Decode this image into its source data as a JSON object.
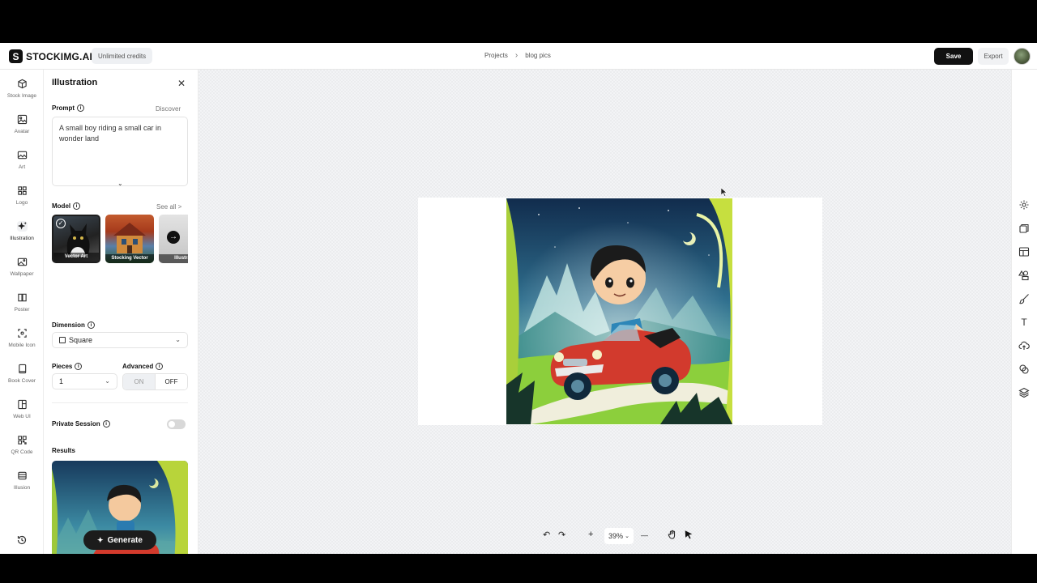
{
  "app": {
    "logo_letter": "S",
    "logo_text": "STOCKIMG.AI",
    "credits_badge": "Unlimited credits"
  },
  "breadcrumb": {
    "projects": "Projects",
    "separator": "›",
    "current": "blog pics"
  },
  "header_actions": {
    "save_label": "Save",
    "export_label": "Export"
  },
  "rail": {
    "items": [
      {
        "label": "Stock Image",
        "icon": "cube-icon"
      },
      {
        "label": "Avatar",
        "icon": "avatar-frame-icon"
      },
      {
        "label": "Art",
        "icon": "image-icon"
      },
      {
        "label": "Logo",
        "icon": "grid-icon"
      },
      {
        "label": "Illustration",
        "icon": "sparkle-icon",
        "active": true
      },
      {
        "label": "Wallpaper",
        "icon": "wallpaper-icon"
      },
      {
        "label": "Poster",
        "icon": "poster-icon"
      },
      {
        "label": "Mobile Icon",
        "icon": "mobile-icon-icon"
      },
      {
        "label": "Book Cover",
        "icon": "book-icon"
      },
      {
        "label": "Web UI",
        "icon": "web-ui-icon"
      },
      {
        "label": "QR Code",
        "icon": "qr-code-icon"
      },
      {
        "label": "Illusion",
        "icon": "illusion-icon"
      }
    ],
    "history_icon": "history-icon"
  },
  "panel": {
    "title": "Illustration",
    "close": "✕",
    "prompt_label": "Prompt",
    "discover_link": "Discover",
    "prompt_text": "A small  boy riding a small car in wonder land",
    "expand": "⌄",
    "model_label": "Model",
    "see_all_link": "See all >",
    "models": [
      {
        "name": "Vector Art",
        "selected": true
      },
      {
        "name": "Stocking Vector"
      },
      {
        "name": "Illustrat"
      }
    ],
    "next_arrow": "→",
    "dimension_label": "Dimension",
    "dimension_value": "Square",
    "pieces_label": "Pieces",
    "pieces_value": "1",
    "advanced_label": "Advanced",
    "advanced_on": "ON",
    "advanced_off": "OFF",
    "advanced_state": "OFF",
    "private_session_label": "Private Session",
    "private_session_enabled": false,
    "results_label": "Results",
    "generate_label": "Generate",
    "info_glyph": "i",
    "chevron_glyph": "⌄"
  },
  "canvas": {
    "zoom": "39%",
    "undo": "↶",
    "redo": "↷",
    "zoom_in": "+",
    "zoom_out": "—"
  },
  "tools": [
    "settings-icon",
    "copy-icon",
    "layout-icon",
    "shapes-icon",
    "brush-icon",
    "text-icon",
    "upload-cloud-icon",
    "stack-icon",
    "layers-icon"
  ],
  "tool_text_glyph": "T"
}
